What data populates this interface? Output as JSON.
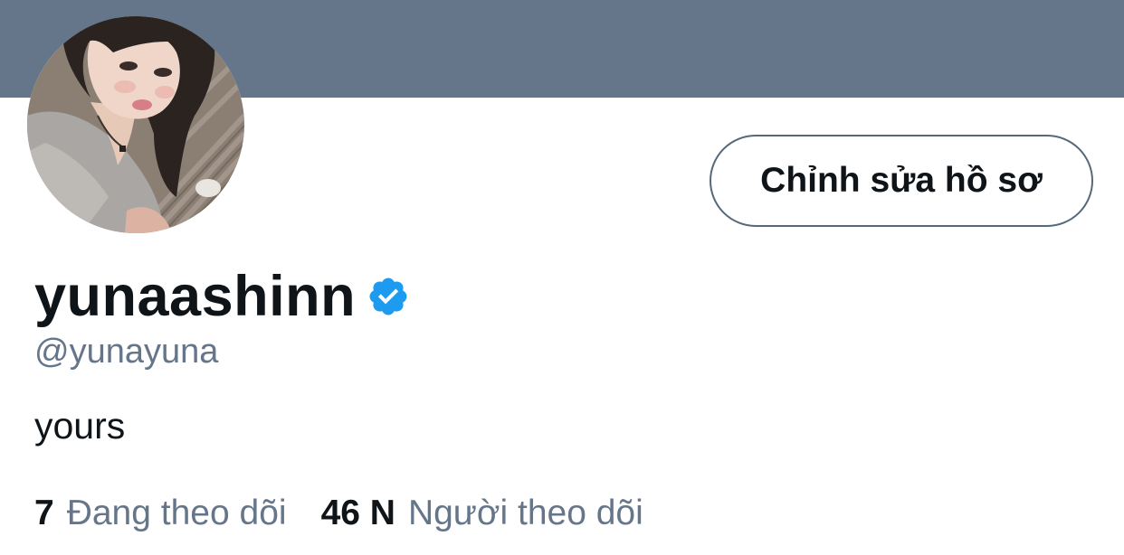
{
  "header": {
    "banner_color": "#66768a"
  },
  "profile": {
    "avatar_icon": "profile-photo",
    "display_name": "yunaashinn",
    "verified": true,
    "verified_color": "#1d9bf0",
    "handle": "@yunayuna",
    "bio": "yours"
  },
  "actions": {
    "edit_profile_label": "Chỉnh sửa hồ sơ"
  },
  "stats": {
    "following_count": "7",
    "following_label": "Đang theo dõi",
    "followers_count": "46 N",
    "followers_label": "Người theo dõi"
  }
}
